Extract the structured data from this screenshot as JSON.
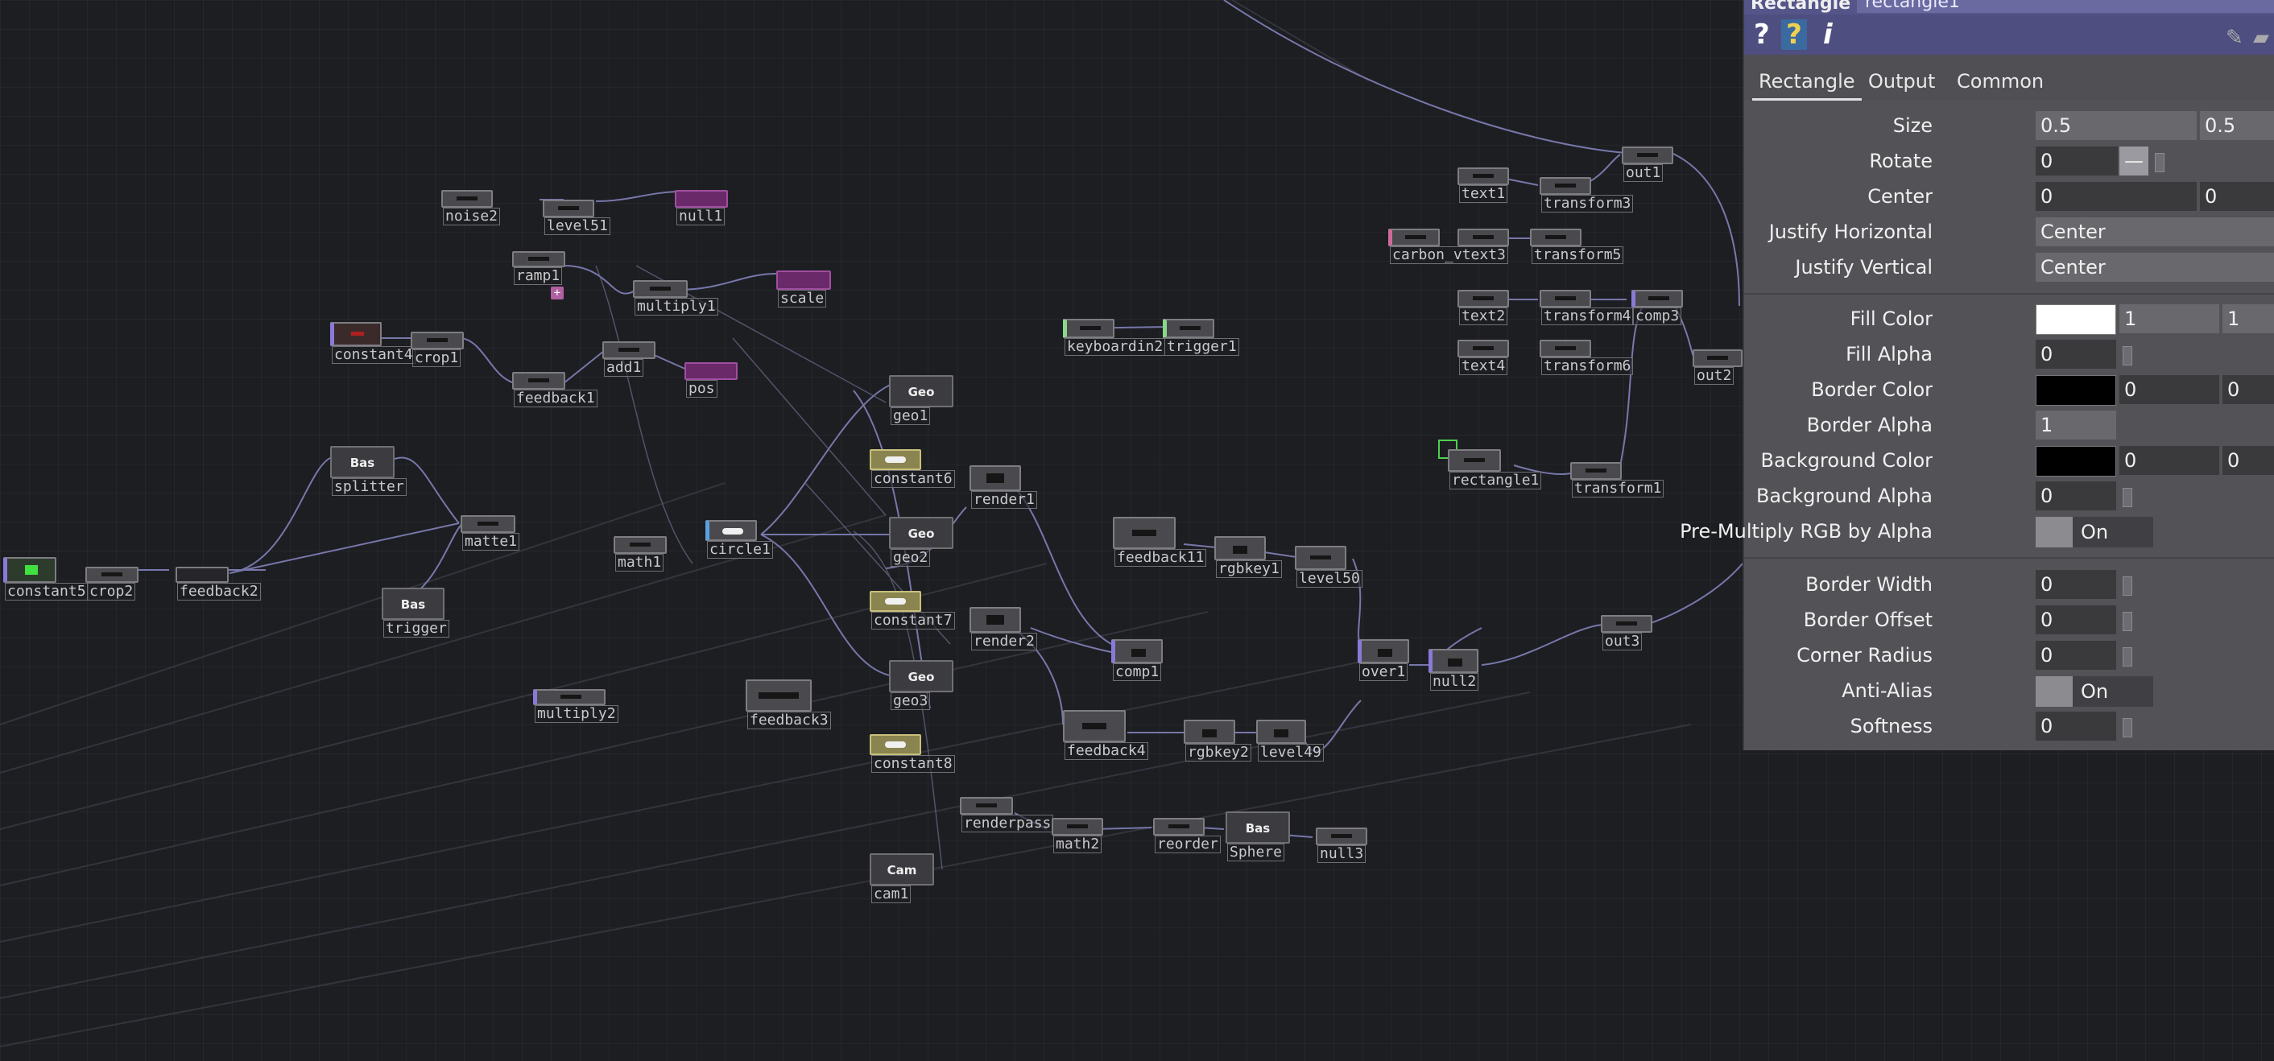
{
  "panel": {
    "op_type": "Rectangle",
    "op_name": "rectangle1",
    "tools": {
      "help": "?",
      "python_help": "?",
      "info": "i"
    },
    "tabs": [
      "Rectangle",
      "Output",
      "Common"
    ],
    "params": {
      "size": {
        "label": "Size",
        "v1": "0.5",
        "v2": "0.5"
      },
      "rotate": {
        "label": "Rotate",
        "v1": "0",
        "slider_btn": "—"
      },
      "center": {
        "label": "Center",
        "v1": "0",
        "v2": "0"
      },
      "justify_h": {
        "label": "Justify Horizontal",
        "value": "Center"
      },
      "justify_v": {
        "label": "Justify Vertical",
        "value": "Center"
      },
      "fill_color": {
        "label": "Fill Color",
        "swatch": "#ffffff",
        "v1": "1",
        "v2": "1"
      },
      "fill_alpha": {
        "label": "Fill Alpha",
        "v1": "0"
      },
      "border_color": {
        "label": "Border Color",
        "swatch": "#000000",
        "v1": "0",
        "v2": "0"
      },
      "border_alpha": {
        "label": "Border Alpha",
        "v1": "1"
      },
      "bg_color": {
        "label": "Background Color",
        "swatch": "#000000",
        "v1": "0",
        "v2": "0"
      },
      "bg_alpha": {
        "label": "Background Alpha",
        "v1": "0"
      },
      "premult": {
        "label": "Pre-Multiply RGB by Alpha",
        "value": "On"
      },
      "border_width": {
        "label": "Border Width",
        "v1": "0"
      },
      "border_offset": {
        "label": "Border Offset",
        "v1": "0"
      },
      "corner_radius": {
        "label": "Corner Radius",
        "v1": "0"
      },
      "anti_alias": {
        "label": "Anti-Alias",
        "value": "On"
      },
      "softness": {
        "label": "Softness",
        "v1": "0"
      }
    }
  },
  "nodes": {
    "noise2": "noise2",
    "level51": "level51",
    "null1": "null1",
    "ramp1": "ramp1",
    "multiply1": "multiply1",
    "scale": "scale",
    "constant4": "constant4",
    "crop1": "crop1",
    "feedback1": "feedback1",
    "add1": "add1",
    "pos": "pos",
    "geo1": "geo1",
    "splitter": "splitter",
    "constant5": "constant5",
    "crop2": "crop2",
    "feedback2": "feedback2",
    "matte1": "matte1",
    "math1": "math1",
    "circle1": "circle1",
    "trigger": "trigger",
    "multiply2": "multiply2",
    "feedback3": "feedback3",
    "constant6": "constant6",
    "geo2": "geo2",
    "constant7": "constant7",
    "geo3": "geo3",
    "constant8": "constant8",
    "render1": "render1",
    "render2": "render2",
    "keyboardin2": "keyboardin2",
    "trigger1": "trigger1",
    "feedback11": "feedback11",
    "rgbkey1": "rgbkey1",
    "level50": "level50",
    "comp1": "comp1",
    "feedback4": "feedback4",
    "rgbkey2": "rgbkey2",
    "level49": "level49",
    "renderpass": "renderpass",
    "math2": "math2",
    "reorder": "reorder",
    "sphere": "Sphere",
    "null3": "null3",
    "cam1": "cam1",
    "text1": "text1",
    "transform3": "transform3",
    "out1": "out1",
    "carbon_vtext3": "carbon_vtext3",
    "transform5": "transform5",
    "text2": "text2",
    "transform4": "transform4",
    "comp3": "comp3",
    "text4": "text4",
    "transform6": "transform6",
    "out2": "out2",
    "rectangle1": "rectangle1",
    "transform1": "transform1",
    "over1": "over1",
    "null2": "null2",
    "out3": "out3"
  },
  "comp_tags": {
    "geo": "Geo",
    "bas": "Bas",
    "cam": "Cam"
  },
  "colors": {
    "selected": "#4fcf4f",
    "accent_panel": "#55558a",
    "wire": "#8a8ab8"
  }
}
